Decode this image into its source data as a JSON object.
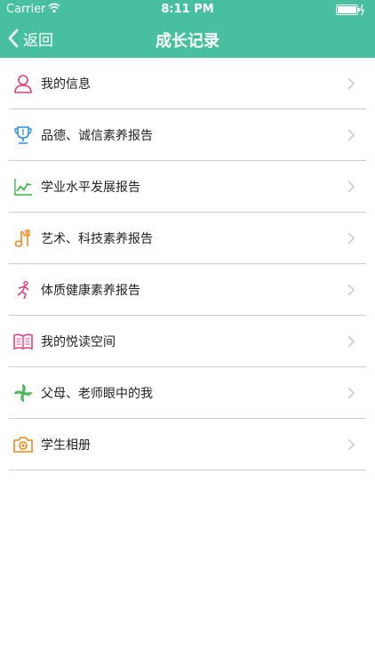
{
  "status_bar": {
    "carrier": "Carrier",
    "time": "8:11 PM"
  },
  "nav": {
    "back_label": "返回",
    "title": "成长记录"
  },
  "colors": {
    "accent": "#48c0a0",
    "divider": "#cfcfcf"
  },
  "menu": {
    "items": [
      {
        "label": "我的信息",
        "icon": "person-icon",
        "color": "#e0407a"
      },
      {
        "label": "品德、诚信素养报告",
        "icon": "trophy-icon",
        "color": "#2f8fe0"
      },
      {
        "label": "学业水平发展报告",
        "icon": "line-chart-icon",
        "color": "#3bb24a"
      },
      {
        "label": "艺术、科技素养报告",
        "icon": "music-icon",
        "color": "#f08a1c"
      },
      {
        "label": "体质健康素养报告",
        "icon": "runner-icon",
        "color": "#e0407a"
      },
      {
        "label": "我的悦读空间",
        "icon": "book-icon",
        "color": "#e0407a"
      },
      {
        "label": "父母、老师眼中的我",
        "icon": "pinwheel-icon",
        "color": "#3bb24a"
      },
      {
        "label": "学生相册",
        "icon": "camera-icon",
        "color": "#f08a1c"
      }
    ]
  }
}
